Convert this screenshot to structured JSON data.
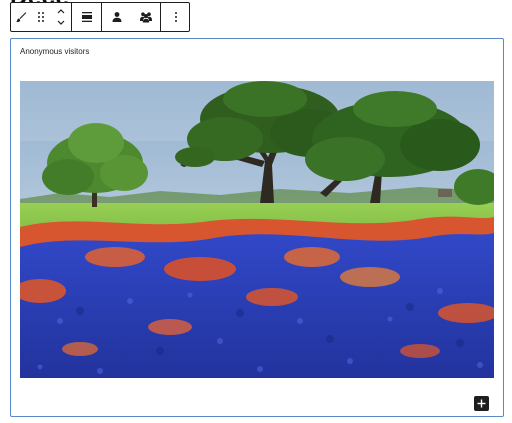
{
  "page": {
    "heading": "Dece"
  },
  "toolbar": {
    "buttons": [
      {
        "icon": "brush-icon",
        "group": "transform"
      },
      {
        "icon": "drag-handle-icon",
        "group": "transform"
      },
      {
        "icon": "move-arrows-icon",
        "group": "transform"
      },
      {
        "icon": "align-icon",
        "group": "alignment"
      },
      {
        "icon": "person-icon",
        "group": "visibility"
      },
      {
        "icon": "group-people-icon",
        "group": "visibility"
      },
      {
        "icon": "more-options-icon",
        "group": "options"
      }
    ]
  },
  "block": {
    "caption": "Anonymous visitors",
    "image": {
      "subject": "bluebonnets-and-paintbrush-wildflower-field",
      "colors": {
        "sky": "#a9c2d8",
        "grass": "#8fc64a",
        "bluebonnet": "#2b3fc4",
        "paintbrush": "#e4502c",
        "tree": "#3f7a28"
      }
    },
    "add_button": {
      "icon": "plus-icon"
    }
  },
  "colors": {
    "selection_border": "#5b88c9",
    "toolbar_border": "#1e1e1e",
    "add_button_bg": "#1e1e1e"
  }
}
